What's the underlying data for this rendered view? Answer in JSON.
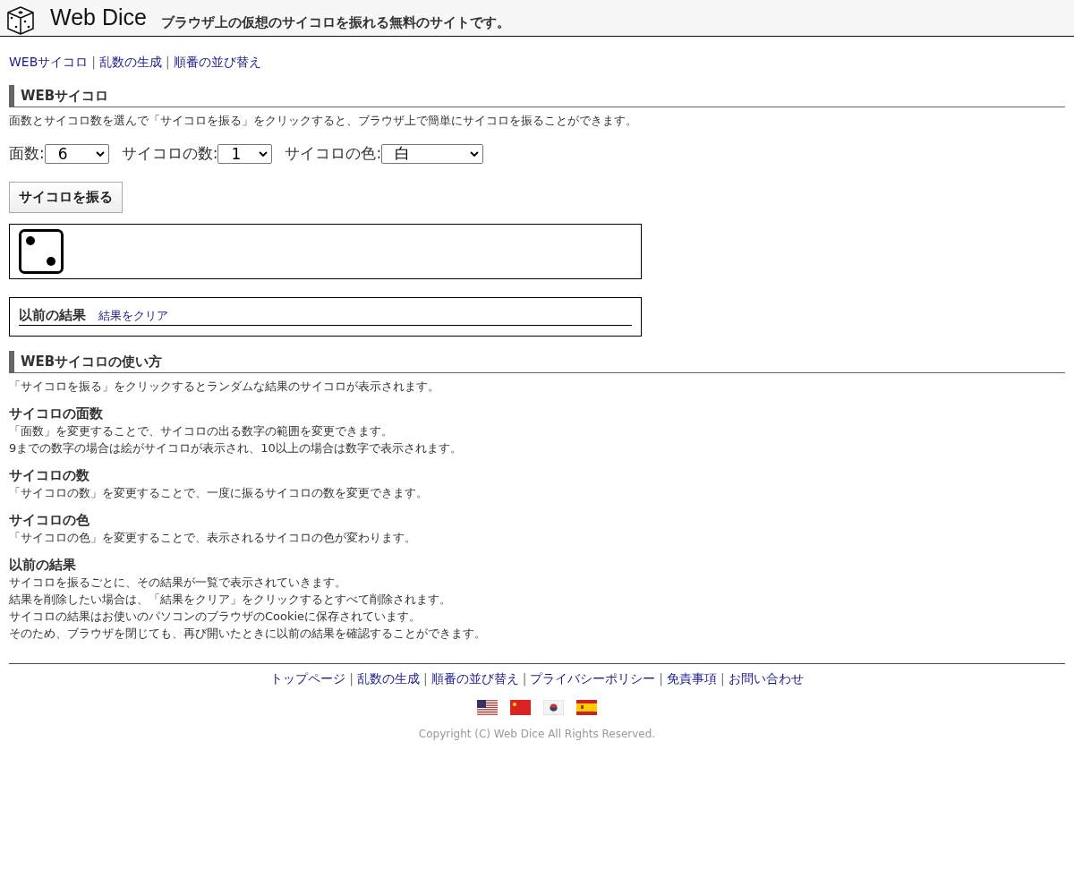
{
  "header": {
    "logo": "Web Dice",
    "tagline": "ブラウザ上の仮想のサイコロを振れる無料のサイトです。"
  },
  "nav": {
    "separator": "|",
    "links": [
      "WEBサイコロ",
      "乱数の生成",
      "順番の並び替え"
    ]
  },
  "dice_section": {
    "title": "WEBサイコロ",
    "intro": "面数とサイコロ数を選んで「サイコロを振る」をクリックすると、ブラウザ上で簡単にサイコロを振ることができます。",
    "selects": [
      {
        "label": "面数:",
        "value": "6"
      },
      {
        "label": "サイコロの数:",
        "value": "1"
      },
      {
        "label": "サイコロの色:",
        "value": "白"
      }
    ],
    "roll_button": "サイコロを振る",
    "dice": [
      {
        "kind": "two"
      }
    ],
    "history": {
      "title": "以前の結果",
      "clear_link": "結果をクリア"
    }
  },
  "help_section": {
    "title": "WEBサイコロの使い方",
    "intro": "「サイコロを振る」をクリックするとランダムな結果のサイコロが表示されます。",
    "topics": [
      {
        "heading": "サイコロの面数",
        "lines": [
          "「面数」を変更することで、サイコロの出る数字の範囲を変更できます。",
          "9までの数字の場合は絵がサイコロが表示され、10以上の場合は数字で表示されます。"
        ]
      },
      {
        "heading": "サイコロの数",
        "lines": [
          "「サイコロの数」を変更することで、一度に振るサイコロの数を変更できます。"
        ]
      },
      {
        "heading": "サイコロの色",
        "lines": [
          "「サイコロの色」を変更することで、表示されるサイコロの色が変わります。"
        ]
      },
      {
        "heading": "以前の結果",
        "lines": [
          "サイコロを振るごとに、その結果が一覧で表示されていきます。",
          "結果を削除したい場合は、「結果をクリア」をクリックするとすべて削除されます。",
          "サイコロの結果はお使いのパソコンのブラウザのCookieに保存されています。",
          "そのため、ブラウザを閉じても、再び開いたときに以前の結果を確認することができます。"
        ]
      }
    ]
  },
  "footer": {
    "separator": "|",
    "links": [
      "トップページ",
      "乱数の生成",
      "順番の並び替え",
      "プライバシーポリシー",
      "免責事項",
      "お問い合わせ"
    ],
    "flags": [
      {
        "kind": "us"
      },
      {
        "kind": "cn"
      },
      {
        "kind": "kr"
      },
      {
        "kind": "es"
      }
    ],
    "copyright": "Copyright (C) Web Dice All Rights Reserved."
  }
}
